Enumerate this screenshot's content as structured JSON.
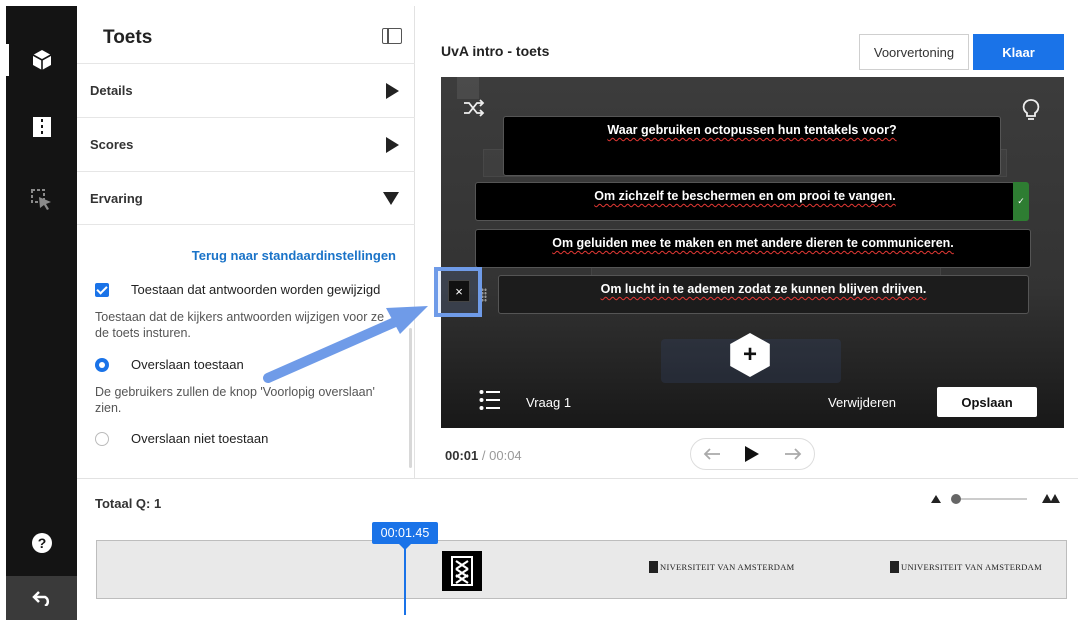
{
  "panel": {
    "title": "Toets",
    "sections": [
      {
        "label": "Details"
      },
      {
        "label": "Scores"
      },
      {
        "label": "Ervaring"
      }
    ],
    "reset_link": "Terug naar standaardinstellingen",
    "allow_change": {
      "label": "Toestaan dat antwoorden worden gewijzigd",
      "description": "Toestaan dat de kijkers antwoorden wijzigen voor ze de toets insturen.",
      "checked": true
    },
    "allow_skip": {
      "label": "Overslaan toestaan",
      "description": "De gebruikers zullen de knop 'Voorlopig overslaan' zien.",
      "selected": true
    },
    "disallow_skip": {
      "label": "Overslaan niet toestaan",
      "selected": false
    }
  },
  "header": {
    "video_title": "UvA intro - toets",
    "preview_label": "Voorvertoning",
    "done_label": "Klaar"
  },
  "quiz": {
    "question": "Waar gebruiken octopussen hun tentakels voor?",
    "answers": [
      {
        "text": "Om zichzelf te beschermen en om prooi te vangen.",
        "correct": true
      },
      {
        "text": "Om geluiden mee te maken en met andere dieren te  communiceren.",
        "correct": false
      },
      {
        "text": "Om lucht in te ademen zodat ze kunnen blijven drijven.",
        "correct": false
      }
    ],
    "correct_mark": "✓",
    "close_mark": "×",
    "add_mark": "+",
    "question_label": "Vraag 1",
    "delete_label": "Verwijderen",
    "save_label": "Opslaan"
  },
  "playback": {
    "current": "00:01",
    "separator": "/",
    "total": "00:04"
  },
  "timeline": {
    "total_label": "Totaal Q: 1",
    "playhead_label": "00:01.45",
    "frame_text_1": "NIVERSITEIT VAN AMSTERDAM",
    "frame_text_2": "UNIVERSITEIT VAN AMSTERDAM"
  },
  "colors": {
    "accent": "#1a73e8",
    "correct": "#2e7d32",
    "highlight": "#6f9be8"
  }
}
